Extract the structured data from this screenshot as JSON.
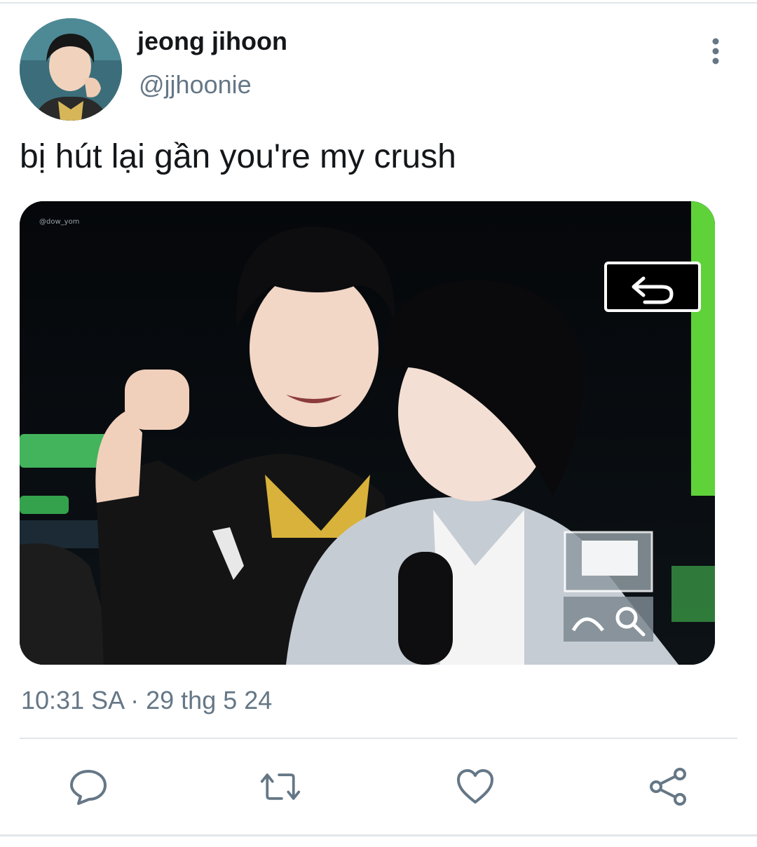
{
  "tweet": {
    "author": {
      "display_name": "jeong jihoon",
      "handle": "@jjhoonie"
    },
    "text": "bị hút lại gần you're my crush",
    "timestamp": "10:31 SA · 29 thg 5 24",
    "media": {
      "watermark": "@dow_yom"
    }
  },
  "icons": {
    "more": "more-vertical-icon",
    "reply": "reply-bubble-icon",
    "retweet": "retweet-icon",
    "like": "heart-icon",
    "share": "share-icon",
    "media_back": "undo-arrow-icon",
    "media_window": "window-icon",
    "media_zoom": "zoom-icon"
  },
  "colors": {
    "text_primary": "#14171a",
    "text_secondary": "#657786",
    "divider": "#e1e6ea",
    "icon": "#657786"
  }
}
